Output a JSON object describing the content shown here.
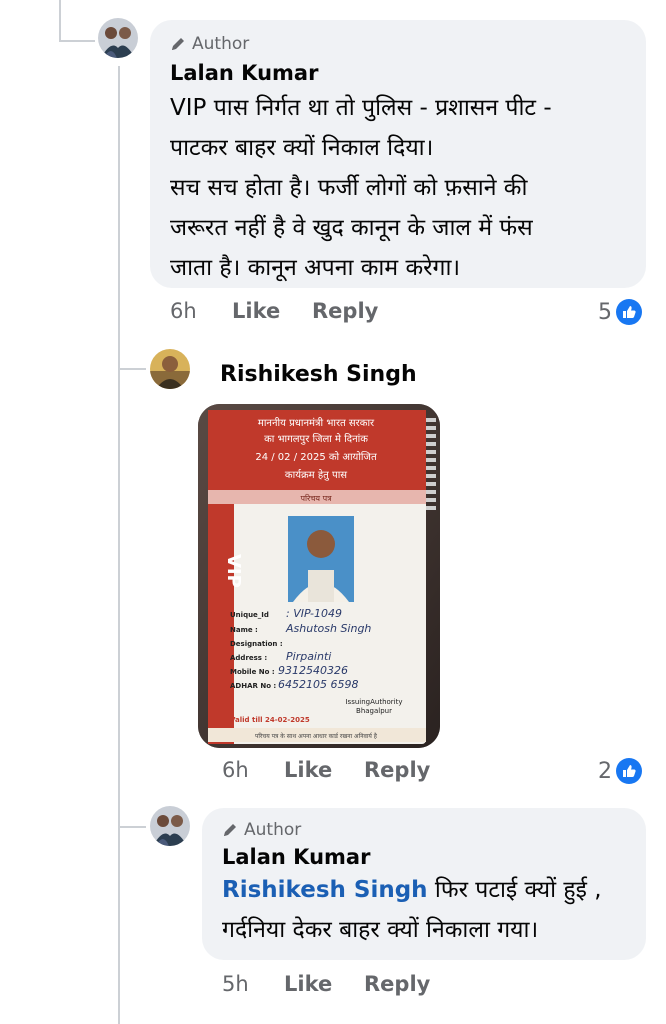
{
  "comments": [
    {
      "author_tag": "Author",
      "name": "Lalan Kumar",
      "lines": [
        "VIP पास निर्गत था तो पुलिस - प्रशासन पीट -",
        "पाटकर बाहर क्यों निकाल दिया।",
        "सच सच होता है। फर्जी लोगों को फ़साने की",
        "जरूरत नहीं है वे खुद कानून के जाल में फंस",
        "जाता है। कानून अपना काम करेगा।"
      ],
      "time": "6h",
      "like": "Like",
      "reply": "Reply",
      "reaction_count": "5"
    },
    {
      "name": "Rishikesh Singh",
      "photo_card": {
        "header_lines": [
          "माननीय प्रधानमंत्री भारत सरकार",
          "का भागलपुर जिला मे दिनांक",
          "24 / 02 / 2025 को आयोजित",
          "कार्यक्रम हेतु पास"
        ],
        "section": "परिचय पत्र",
        "vip": "VIP",
        "fields": [
          {
            "label": "Unique_Id",
            "value": ": VIP-1049"
          },
          {
            "label": "Name :",
            "value": "Ashutosh Singh"
          },
          {
            "label": "Designation :",
            "value": ""
          },
          {
            "label": "Address :",
            "value": "Pirpainti"
          },
          {
            "label": "Mobile No :",
            "value": "9312540326"
          },
          {
            "label": "ADHAR No :",
            "value": "6452105 6598"
          }
        ],
        "issuing": "IssuingAuthority",
        "issuing_place": "Bhagalpur",
        "valid": "Valid till 24-02-2025",
        "footer": "परिचय पत्र के साथ अपना आधार कार्ड रखना अनिवार्य है"
      },
      "time": "6h",
      "like": "Like",
      "reply": "Reply",
      "reaction_count": "2"
    },
    {
      "author_tag": "Author",
      "name": "Lalan Kumar",
      "mention": "Rishikesh Singh",
      "lines": [
        " फिर पटाई क्यों हुई ,",
        "गर्दनिया देकर बाहर क्यों निकाला गया।"
      ],
      "time": "5h",
      "like": "Like",
      "reply": "Reply"
    }
  ],
  "colors": {
    "bubble": "#f0f2f5",
    "like_blue": "#1877f2",
    "mention": "#1b5fb4",
    "meta_gray": "#65676b"
  }
}
